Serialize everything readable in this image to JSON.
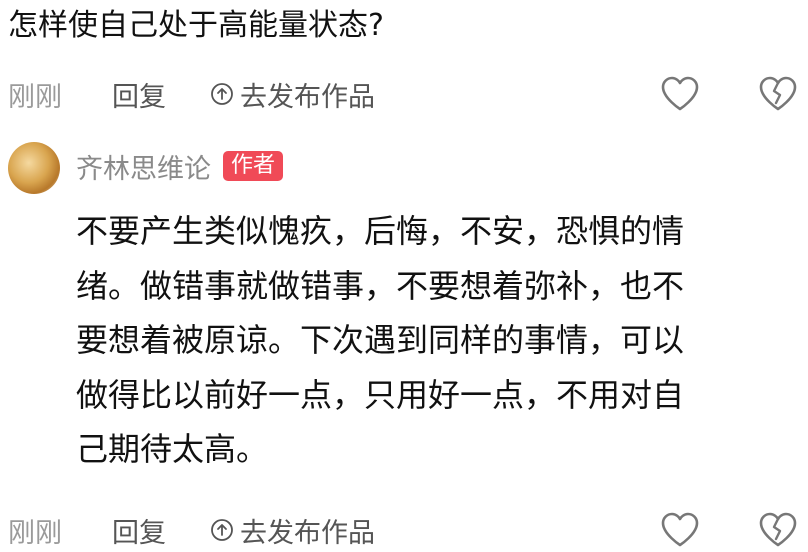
{
  "question": "怎样使自己处于高能量状态?",
  "top_actions": {
    "time": "刚刚",
    "reply": "回复",
    "publish": "去发布作品"
  },
  "reply_comment": {
    "author": "齐林思维论",
    "badge": "作者",
    "lines": [
      "不要产生类似愧疚，后悔，不安，恐惧的情",
      "绪。做错事就做错事，不要想着弥补，也不",
      "要想着被原谅。下次遇到同样的事情，可以",
      "做得比以前好一点，只用好一点，不用对自",
      "己期待太高。"
    ]
  },
  "bottom_actions": {
    "time": "刚刚",
    "reply": "回复",
    "publish": "去发布作品"
  },
  "colors": {
    "badge_red": "#f04a57",
    "muted_gray": "#9a9a9a",
    "icon_gray": "#777777"
  },
  "icons": {
    "publish": "upload-circle-icon",
    "like": "heart-icon",
    "dislike": "broken-heart-icon"
  }
}
